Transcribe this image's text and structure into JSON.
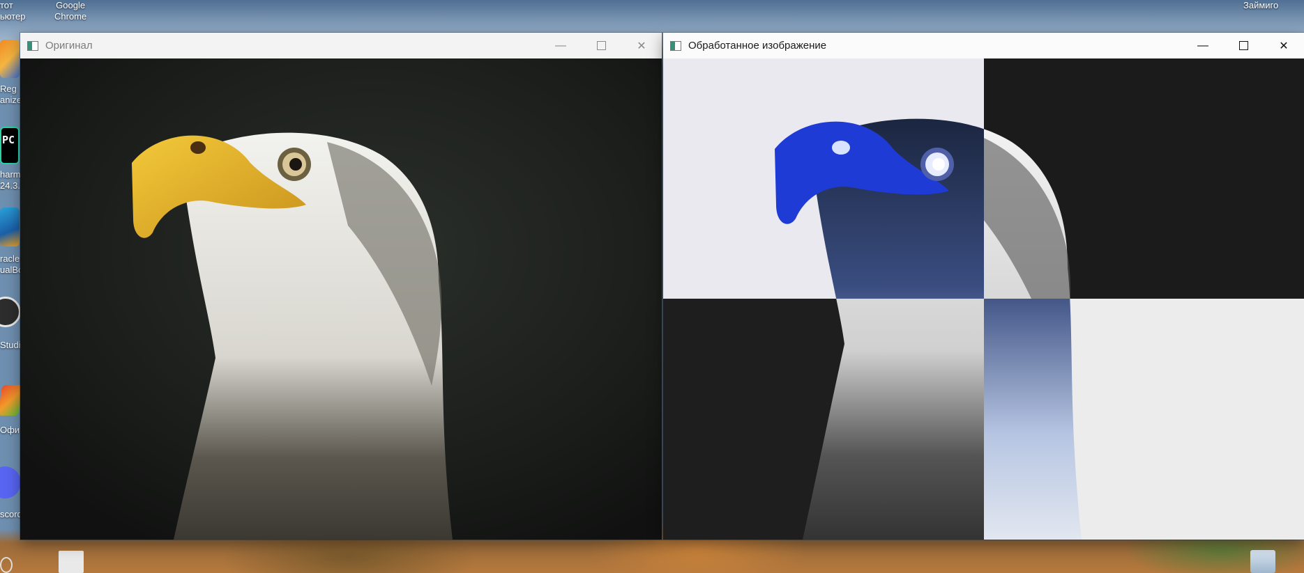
{
  "desktop": {
    "icons": [
      {
        "name": "this-pc",
        "label_line1": "тот",
        "label_line2": "ьютер"
      },
      {
        "name": "google-chrome",
        "label_line1": "Google",
        "label_line2": "Chrome"
      },
      {
        "name": "reg-organizer",
        "label_line1": "Reg",
        "label_line2": "anize"
      },
      {
        "name": "pycharm",
        "label_line1": "harm",
        "label_line2": "24.3.5"
      },
      {
        "name": "oracle-virtualbox",
        "label_line1": "racle",
        "label_line2": "ualBo"
      },
      {
        "name": "obs-studio",
        "label_line1": "Studi",
        "label_line2": ""
      },
      {
        "name": "office",
        "label_line1": "Офи",
        "label_line2": ""
      },
      {
        "name": "discord",
        "label_line1": "scord",
        "label_line2": ""
      },
      {
        "name": "zaymigo",
        "label_line1": "Займиго",
        "label_line2": ""
      }
    ]
  },
  "windows": {
    "original": {
      "title": "Оригинал"
    },
    "processed": {
      "title": "Обработанное изображение"
    }
  },
  "colors": {
    "beak_original": "#e9b92a",
    "beak_processed": "#1f3bd6",
    "dark_bg": "#1a1c1a",
    "light_bg": "#eceaf0"
  }
}
